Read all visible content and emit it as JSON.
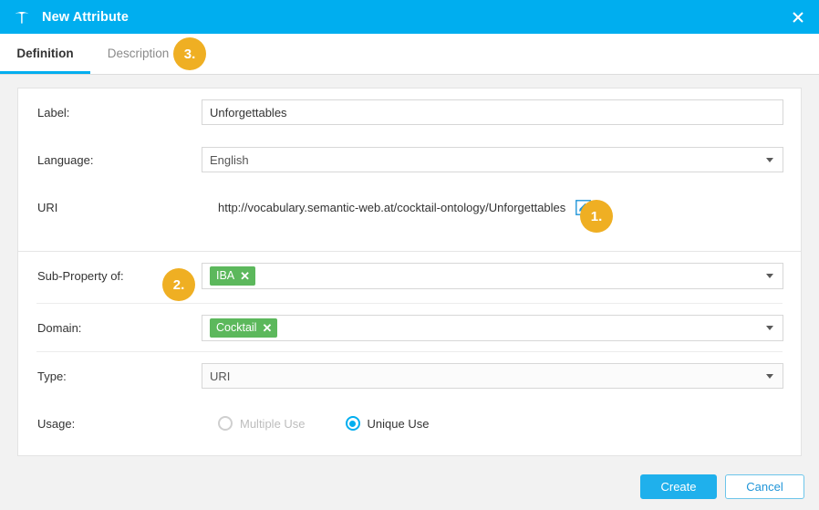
{
  "window": {
    "title": "New Attribute",
    "app_icon": "poolparty-logo-icon",
    "close_icon": "close-icon",
    "accent_color": "#00AEEF"
  },
  "tabs": [
    {
      "label": "Definition",
      "active": true
    },
    {
      "label": "Description",
      "active": false
    }
  ],
  "form": {
    "label": {
      "label": "Label:",
      "value": "Unforgettables"
    },
    "language": {
      "label": "Language:",
      "value": "English"
    },
    "uri": {
      "label": "URI",
      "value": "http://vocabulary.semantic-web.at/cocktail-ontology/Unforgettables",
      "edit_icon": "edit-pencil-icon"
    },
    "sub_property": {
      "label": "Sub-Property of:",
      "tags": [
        {
          "text": "IBA",
          "remove": "✕",
          "color": "#5CB85C"
        }
      ]
    },
    "domain": {
      "label": "Domain:",
      "tags": [
        {
          "text": "Cocktail",
          "remove": "✕",
          "color": "#5CB85C"
        }
      ]
    },
    "type": {
      "label": "Type:",
      "value": "URI"
    },
    "usage": {
      "label": "Usage:",
      "options": [
        {
          "label": "Multiple Use",
          "selected": false,
          "disabled": true
        },
        {
          "label": "Unique Use",
          "selected": true,
          "disabled": false
        }
      ]
    }
  },
  "footer": {
    "create_label": "Create",
    "cancel_label": "Cancel"
  },
  "callouts": [
    {
      "id": "1",
      "text": "1."
    },
    {
      "id": "2",
      "text": "2."
    },
    {
      "id": "3",
      "text": "3."
    }
  ]
}
